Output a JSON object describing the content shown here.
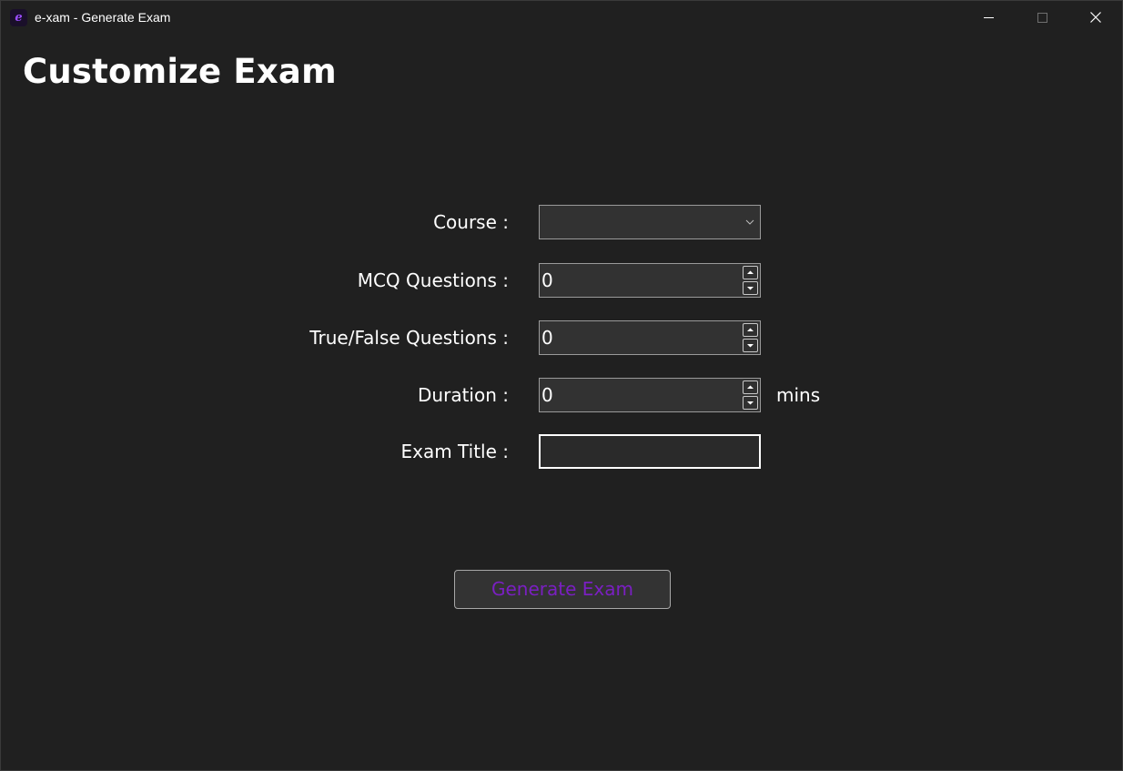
{
  "window": {
    "title": "e-xam - Generate Exam",
    "icon_glyph": "e",
    "icon": "app-logo-icon",
    "controls": [
      "minimize-icon",
      "maximize-icon",
      "close-icon"
    ]
  },
  "page": {
    "title": "Customize Exam"
  },
  "form": {
    "course": {
      "label": "Course :",
      "value": ""
    },
    "mcq": {
      "label": "MCQ Questions :",
      "value": "0"
    },
    "true_false": {
      "label": "True/False Questions :",
      "value": "0"
    },
    "duration": {
      "label": "Duration :",
      "value": "0",
      "unit": "mins"
    },
    "exam_title": {
      "label": "Exam Title :",
      "value": ""
    }
  },
  "actions": {
    "generate_label": "Generate Exam"
  },
  "colors": {
    "background": "#202020",
    "accent": "#7a1fc2",
    "field": "#323232"
  }
}
